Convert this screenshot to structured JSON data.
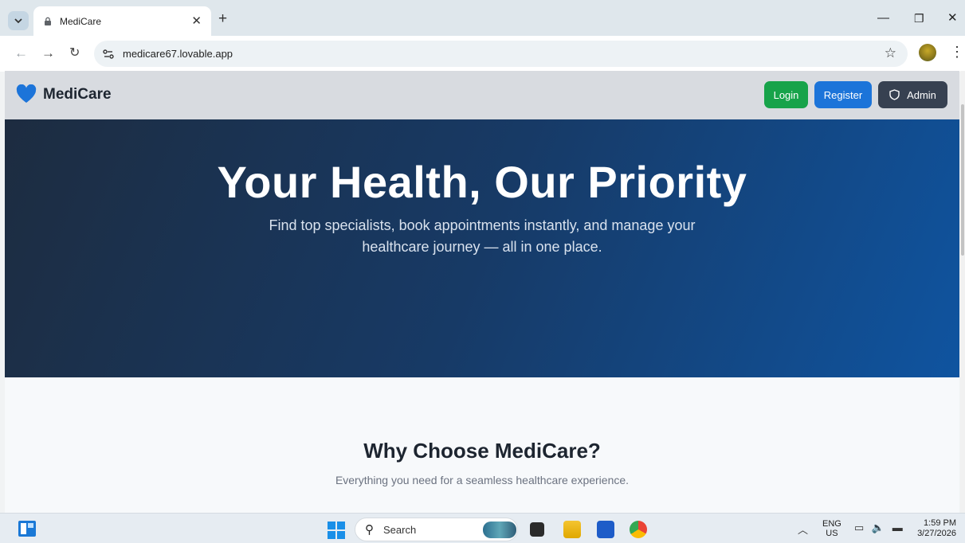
{
  "browser": {
    "tab_title": "MediCare",
    "url": "medicare67.lovable.app"
  },
  "site": {
    "brand": "MediCare",
    "nav": {
      "login": "Login",
      "register": "Register",
      "admin": "Admin"
    },
    "hero": {
      "title": "Your Health, Our Priority",
      "subtitle": "Find top specialists, book appointments instantly, and manage your healthcare journey — all in one place."
    },
    "features": {
      "heading": "Why Choose MediCare?",
      "subheading": "Everything you need for a seamless healthcare experience."
    }
  },
  "taskbar": {
    "search_label": "Search",
    "lang_top": "ENG",
    "lang_bottom": "US",
    "time": "1:59 PM",
    "date": "3/27/2026"
  },
  "colors": {
    "brand_blue": "#1c74d9",
    "login_green": "#17a34a",
    "admin_dark": "#374151",
    "hero_start": "#1d2c40",
    "hero_end": "#0f54a0"
  },
  "icons": [
    "tab-search-icon",
    "lock-favicon-icon",
    "close-icon",
    "plus-icon",
    "minimize-icon",
    "restore-icon",
    "back-arrow-icon",
    "forward-arrow-icon",
    "reload-icon",
    "site-settings-icon",
    "bookmark-star-icon",
    "profile-avatar-icon",
    "menu-kebab-icon",
    "heart-logo-icon",
    "shield-icon",
    "widgets-icon",
    "windows-start-icon",
    "search-icon"
  ]
}
